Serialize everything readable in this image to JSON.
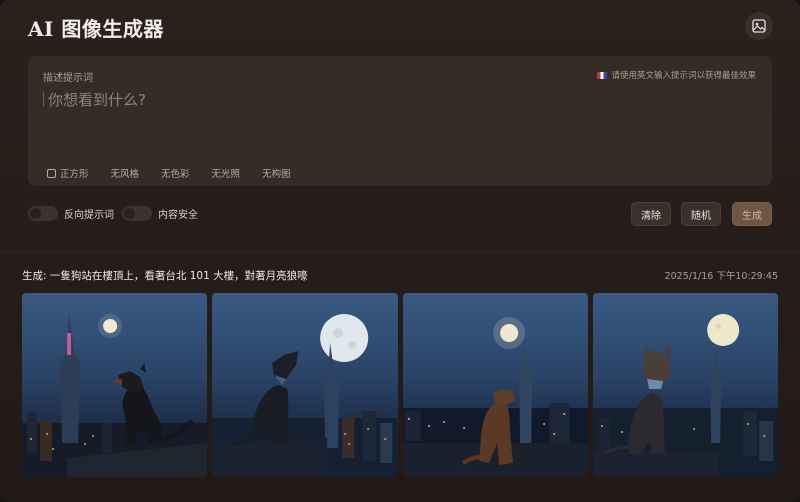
{
  "app": {
    "title": "AI 图像生成器"
  },
  "header": {
    "image_icon": "image-icon"
  },
  "prompt": {
    "label": "描述提示词",
    "placeholder": "你想看到什么?",
    "value": "",
    "lang_hint": "请使用英文输入提示词以获得最佳效果"
  },
  "styles": [
    {
      "label": "正方形",
      "checkbox": true
    },
    {
      "label": "无风格"
    },
    {
      "label": "无色彩"
    },
    {
      "label": "无光照"
    },
    {
      "label": "无构图"
    }
  ],
  "toggles": {
    "negative_prompt": "反向提示词",
    "content_safety": "内容安全"
  },
  "buttons": {
    "clear": "清除",
    "random": "随机",
    "generate": "生成"
  },
  "result": {
    "prefix": "生成:",
    "prompt": "一隻狗站在樓頂上，看著台北 101 大樓，對著月亮狼嚎",
    "timestamp": "2025/1/16 下午10:29:45"
  },
  "colors": {
    "background": "#221a17",
    "panel": "#362c27",
    "accent": "#6e5545"
  }
}
